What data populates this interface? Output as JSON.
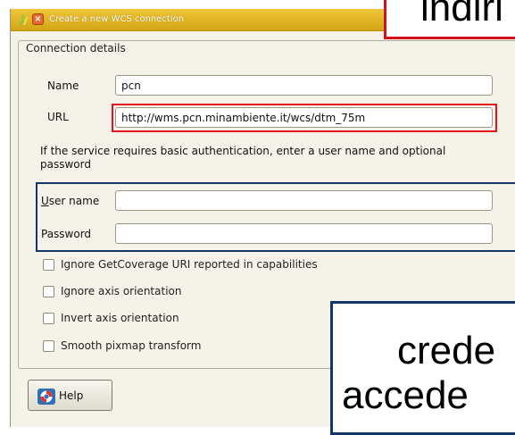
{
  "window": {
    "title": "Create a new WCS connection",
    "close_glyph": "×"
  },
  "group": {
    "title": "Connection details"
  },
  "fields": {
    "name": {
      "label": "Name",
      "value": "pcn"
    },
    "url": {
      "label": "URL",
      "value": "http://wms.pcn.minambiente.it/wcs/dtm_75m"
    },
    "username": {
      "label_underlined": "U",
      "label_rest": "ser name",
      "value": ""
    },
    "password": {
      "label": "Password",
      "value": ""
    }
  },
  "auth_info": "If the service requires basic authentication, enter a user name and optional password",
  "options": [
    {
      "label": "Ignore GetCoverage URI reported in capabilities",
      "checked": false
    },
    {
      "label": "Ignore axis orientation",
      "checked": false
    },
    {
      "label": "Invert axis orientation",
      "checked": false
    },
    {
      "label": "Smooth pixmap transform",
      "checked": false
    }
  ],
  "buttons": {
    "help": "Help"
  },
  "annotations": {
    "top_text": "indiri",
    "bottom_line1": "crede",
    "bottom_line2": "accede"
  },
  "colors": {
    "titlebar": "#e0b324",
    "dialog_bg": "#f4f2e9",
    "highlight_red": "#e4121b",
    "highlight_blue": "#123766"
  },
  "icons": {
    "app": "qgis-logo-icon",
    "close": "close-icon",
    "help": "help-lifebuoy-icon"
  }
}
